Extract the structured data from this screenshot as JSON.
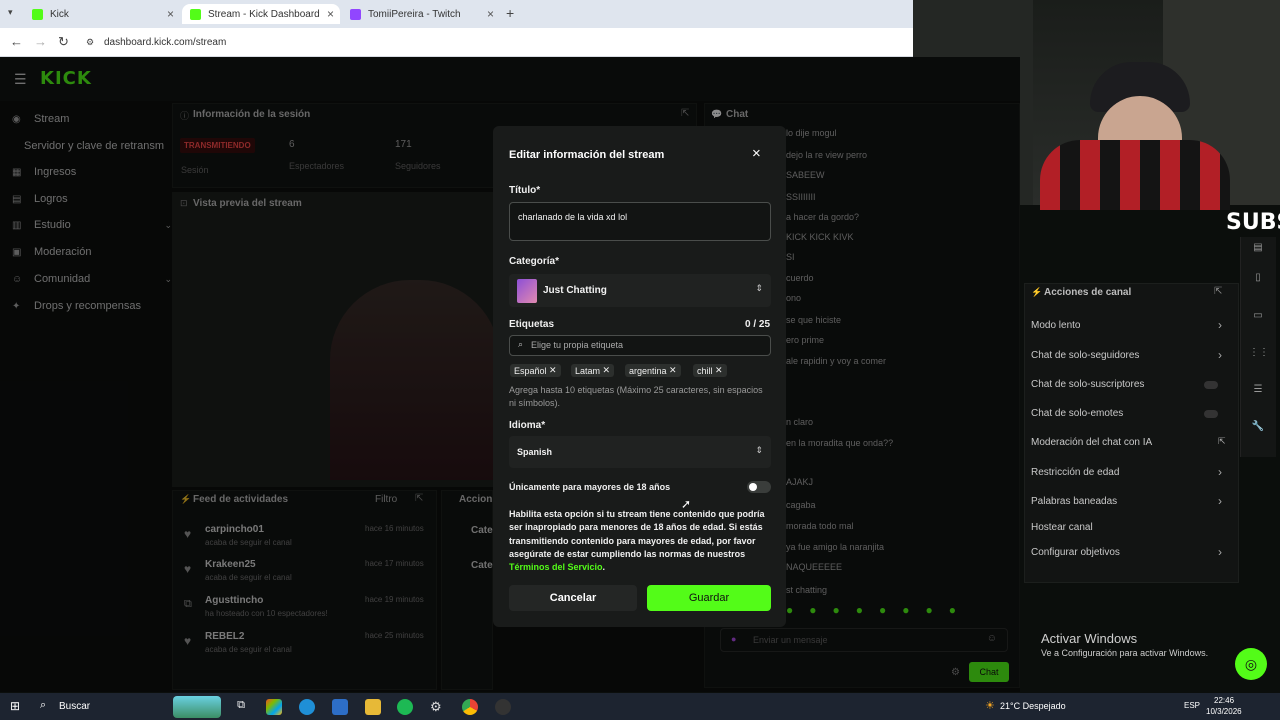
{
  "browser": {
    "tabs": [
      {
        "label": "Kick",
        "favicon_color": "#53fc18"
      },
      {
        "label": "Stream - Kick Dashboard",
        "favicon_color": "#53fc18"
      },
      {
        "label": "TomiiPereira - Twitch",
        "favicon_color": "#9146ff"
      }
    ],
    "url": "dashboard.kick.com/stream"
  },
  "webcam": {
    "overlay_text": "SUBS"
  },
  "dashboard": {
    "logo": "KICK",
    "sidebar": [
      {
        "label": "Stream",
        "icon": "stream-icon",
        "active": true
      },
      {
        "label": "Servidor y clave de retransm",
        "icon": "",
        "active": false
      },
      {
        "label": "Ingresos",
        "icon": "money-icon",
        "active": false
      },
      {
        "label": "Logros",
        "icon": "trophy-icon",
        "active": false
      },
      {
        "label": "Estudio",
        "icon": "studio-icon",
        "active": false
      },
      {
        "label": "Moderación",
        "icon": "shield-icon",
        "active": false
      },
      {
        "label": "Comunidad",
        "icon": "people-icon",
        "active": false
      },
      {
        "label": "Drops y recompensas",
        "icon": "gift-icon",
        "active": false
      }
    ],
    "session": {
      "title": "Información de la sesión",
      "status": "TRANSMITIENDO",
      "status_label": "Sesión",
      "viewers": "6",
      "viewers_label": "Espectadores",
      "followers": "171",
      "followers_label": "Seguidores"
    },
    "preview_title": "Vista previa del stream",
    "feed": {
      "title": "Feed de actividades",
      "filter_label": "Filtro",
      "items": [
        {
          "user": "carpincho01",
          "action": "acaba de seguir el canal",
          "time": "hace 16 minutos"
        },
        {
          "user": "Krakeen25",
          "action": "acaba de seguir el canal",
          "time": "hace 17 minutos"
        },
        {
          "user": "Agusttincho",
          "action": "ha hosteado con 10 espectadores!",
          "time": "hace 19 minutos"
        },
        {
          "user": "REBEL2",
          "action": "acaba de seguir el canal",
          "time": "hace 25 minutos"
        }
      ]
    },
    "actions_partial": {
      "title": "Accion",
      "cat1": "Cate",
      "cat2": "Cate"
    },
    "chat": {
      "title": "Chat",
      "lines": [
        "lo dije mogul",
        "dejo la re view perro",
        "SABEEW",
        "SSIIIIIII",
        "a hacer da gordo?",
        "KICK KICK KIVK",
        "SI",
        "cuerdo",
        "ono",
        "se que hiciste",
        "ero prime",
        "ale rapidin y voy a comer",
        "n claro",
        "en la moradita que onda??",
        "AJAKJ",
        "cagaba",
        "morada todo mal",
        "ya fue amigo la naranjita",
        "NAQUEEEEE",
        "st chatting"
      ],
      "input_placeholder": "Enviar un mensaje",
      "send_label": "Chat"
    },
    "channel_actions": {
      "title": "Acciones de canal",
      "items": [
        {
          "label": "Modo lento",
          "control": "chevron"
        },
        {
          "label": "Chat de solo-seguidores",
          "control": "chevron"
        },
        {
          "label": "Chat de solo-suscriptores",
          "control": "toggle"
        },
        {
          "label": "Chat de solo-emotes",
          "control": "toggle"
        },
        {
          "label": "Moderación del chat con IA",
          "control": "link"
        },
        {
          "label": "Restricción de edad",
          "control": "chevron"
        },
        {
          "label": "Palabras baneadas",
          "control": "chevron"
        },
        {
          "label": "Hostear canal",
          "control": "none"
        },
        {
          "label": "Configurar objetivos",
          "control": "chevron"
        }
      ]
    }
  },
  "modal": {
    "title": "Editar información del stream",
    "title_label": "Título*",
    "title_value": "charlanado de la vida xd lol",
    "category_label": "Categoría*",
    "category_value": "Just Chatting",
    "tags_label": "Etiquetas",
    "tags_count": "0 / 25",
    "tags_placeholder": "Elige tu propia etiqueta",
    "tags": [
      "Español",
      "Latam",
      "argentina",
      "chill"
    ],
    "tags_help": "Agrega hasta 10 etiquetas (Máximo 25 caracteres, sin espacios ni símbolos).",
    "language_label": "Idioma*",
    "language_value": "Spanish",
    "adult_label": "Únicamente para mayores de 18 años",
    "adult_enabled": false,
    "adult_help": "Habilita esta opción si tu stream tiene contenido que podría ser inapropiado para menores de 18 años de edad. Si estás transmitiendo contenido para mayores de edad, por favor asegúrate de estar cumpliendo las normas de nuestros",
    "terms_link": "Términos del Servicio",
    "terms_end": ".",
    "cancel_label": "Cancelar",
    "save_label": "Guardar",
    "accent": "#53fc18"
  },
  "windows_watermark": {
    "title": "Activar Windows",
    "subtitle": "Ve a Configuración para activar Windows."
  },
  "taskbar": {
    "search_label": "Buscar",
    "weather": "21°C  Despejado",
    "lang": "ESP",
    "time": "22:46",
    "date": "10/3/2026"
  }
}
